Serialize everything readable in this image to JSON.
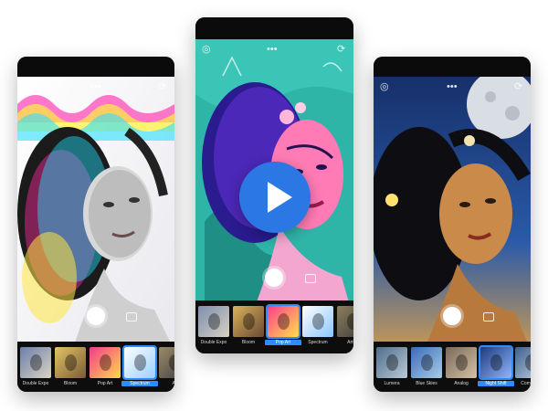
{
  "phones": {
    "left": {
      "icons": [
        "circle-icon",
        "menu-dots-icon",
        "refresh-icon"
      ],
      "filters": [
        {
          "label": "Double Expo",
          "colors": [
            "#6b7fa8",
            "#d9d3c5"
          ],
          "selected": false
        },
        {
          "label": "Bloom",
          "colors": [
            "#e5c463",
            "#7a5b3a"
          ],
          "selected": false
        },
        {
          "label": "Pop Art",
          "colors": [
            "#f23b8b",
            "#ffd84a"
          ],
          "selected": false
        },
        {
          "label": "Spectrum",
          "colors": [
            "#ffffff",
            "#9ad0ff"
          ],
          "selected": true
        },
        {
          "label": "Ar",
          "colors": [
            "#9b8b6b",
            "#3b3b3b"
          ],
          "selected": false
        }
      ]
    },
    "center": {
      "icons": [
        "circle-icon",
        "menu-dots-icon",
        "refresh-icon"
      ],
      "filters": [
        {
          "label": "Double Expo",
          "colors": [
            "#7d8fb0",
            "#d8d0c2"
          ],
          "selected": false
        },
        {
          "label": "Bloom",
          "colors": [
            "#d9b25a",
            "#6b4a34"
          ],
          "selected": false
        },
        {
          "label": "Pop Art",
          "colors": [
            "#ff3c8e",
            "#ffe04b"
          ],
          "selected": true
        },
        {
          "label": "Spectrum",
          "colors": [
            "#ffffff",
            "#8cc7ff"
          ],
          "selected": false
        },
        {
          "label": "Artful",
          "colors": [
            "#8d7e5c",
            "#3a3a3a"
          ],
          "selected": false
        }
      ]
    },
    "right": {
      "icons": [
        "circle-icon",
        "menu-dots-icon",
        "refresh-icon"
      ],
      "filters": [
        {
          "label": "Lumera",
          "colors": [
            "#4f6d8a",
            "#b8c9d6"
          ],
          "selected": false
        },
        {
          "label": "Blue Skies",
          "colors": [
            "#3a6bb8",
            "#a8cde8"
          ],
          "selected": false
        },
        {
          "label": "Analog",
          "colors": [
            "#7a6a5a",
            "#d3c0a5"
          ],
          "selected": false
        },
        {
          "label": "Night Shift",
          "colors": [
            "#1e3a7a",
            "#8fb6ff"
          ],
          "selected": true
        },
        {
          "label": "Comic Sk",
          "colors": [
            "#3f5f8f",
            "#c3d3e3"
          ],
          "selected": false
        }
      ]
    }
  },
  "colors": {
    "accent": "#2b78e4",
    "selection": "#2d8cff",
    "phone_body": "#111111"
  }
}
